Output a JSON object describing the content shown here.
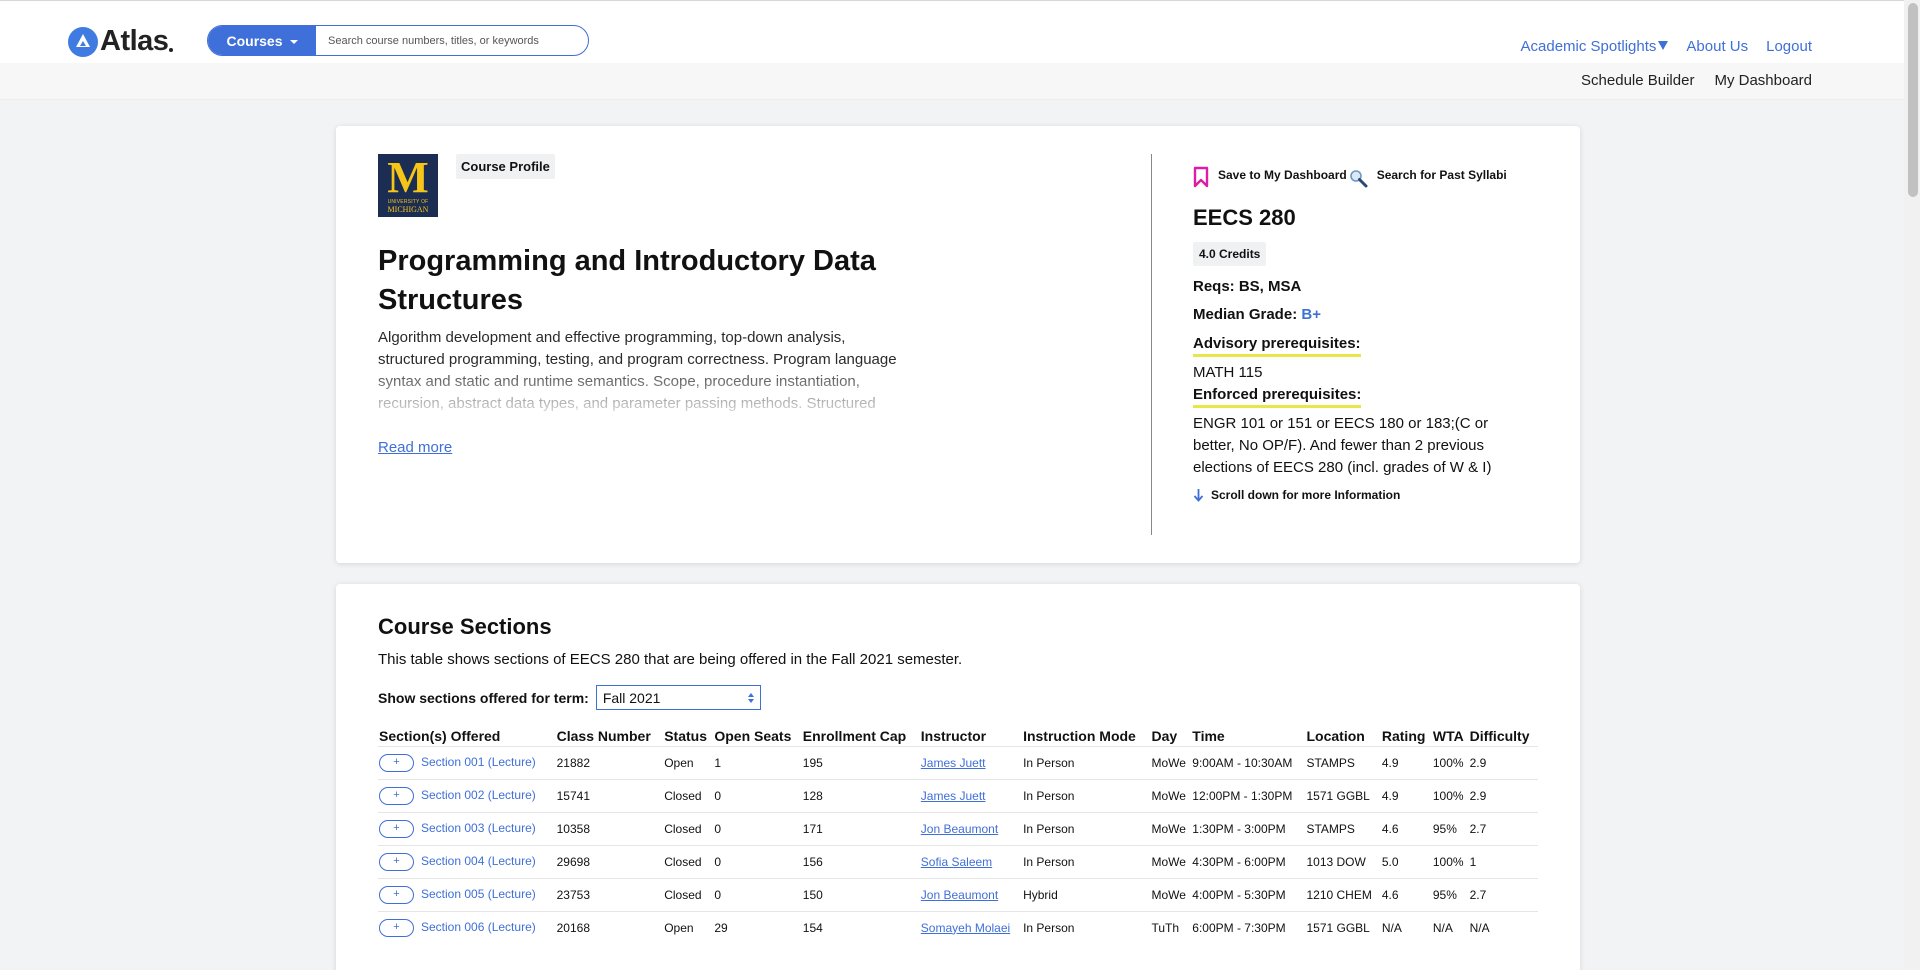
{
  "header": {
    "logo_text": "Atlas",
    "courses_label": "Courses",
    "search_placeholder": "Search course numbers, titles, or keywords",
    "nav_links": [
      "Academic Spotlights",
      "About Us",
      "Logout"
    ],
    "sub_links": [
      "Schedule Builder",
      "My Dashboard"
    ]
  },
  "colors": {
    "accent": "#3f6fd8",
    "highlight": "#e9e64a",
    "bookmark": "#e01ca4",
    "um_blue": "#1b2d52",
    "um_maize": "#f5c518"
  },
  "profile": {
    "logo_letter": "M",
    "logo_university": "UNIVERSITY OF",
    "logo_michigan": "MICHIGAN",
    "badge": "Course Profile",
    "title": "Programming and Introductory Data Structures",
    "description": "Algorithm development and effective programming, top-down analysis, structured programming, testing, and program correctness. Program language syntax and static and runtime semantics. Scope, procedure instantiation, recursion, abstract data types, and parameter passing methods. Structured",
    "read_more": "Read more",
    "save_label": "Save to My Dashboard",
    "syllabi_label": "Search for Past Syllabi",
    "code": "EECS 280",
    "credits": "4.0 Credits",
    "reqs": "Reqs: BS, MSA",
    "median_label": "Median Grade:",
    "median_value": "B+",
    "advisory_heading": "Advisory prerequisites:",
    "advisory_value": "MATH 115",
    "enforced_heading": "Enforced prerequisites:",
    "enforced_value": "ENGR 101 or 151 or EECS 180 or 183;(C or better, No OP/F). And fewer than 2 previous elections of EECS 280 (incl. grades of W & I)",
    "scroll_more": "Scroll down for more Information"
  },
  "sections": {
    "title": "Course Sections",
    "description": "This table shows sections of EECS 280 that are being offered in the Fall 2021 semester.",
    "term_label": "Show sections offered for term:",
    "term_value": "Fall 2021",
    "plus_label": "+",
    "columns": [
      "Section(s) Offered",
      "Class Number",
      "Status",
      "Open Seats",
      "Enrollment Cap",
      "Instructor",
      "Instruction Mode",
      "Day",
      "Time",
      "Location",
      "Rating",
      "WTA",
      "Difficulty"
    ],
    "rows": [
      [
        "Section 001 (Lecture)",
        "21882",
        "Open",
        "1",
        "195",
        "James Juett",
        "In Person",
        "MoWe",
        "9:00AM - 10:30AM",
        "STAMPS",
        "4.9",
        "100%",
        "2.9"
      ],
      [
        "Section 002 (Lecture)",
        "15741",
        "Closed",
        "0",
        "128",
        "James Juett",
        "In Person",
        "MoWe",
        "12:00PM - 1:30PM",
        "1571 GGBL",
        "4.9",
        "100%",
        "2.9"
      ],
      [
        "Section 003 (Lecture)",
        "10358",
        "Closed",
        "0",
        "171",
        "Jon Beaumont",
        "In Person",
        "MoWe",
        "1:30PM - 3:00PM",
        "STAMPS",
        "4.6",
        "95%",
        "2.7"
      ],
      [
        "Section 004 (Lecture)",
        "29698",
        "Closed",
        "0",
        "156",
        "Sofia Saleem",
        "In Person",
        "MoWe",
        "4:30PM - 6:00PM",
        "1013 DOW",
        "5.0",
        "100%",
        "1"
      ],
      [
        "Section 005 (Lecture)",
        "23753",
        "Closed",
        "0",
        "150",
        "Jon Beaumont",
        "Hybrid",
        "MoWe",
        "4:00PM - 5:30PM",
        "1210 CHEM",
        "4.6",
        "95%",
        "2.7"
      ],
      [
        "Section 006 (Lecture)",
        "20168",
        "Open",
        "29",
        "154",
        "Somayeh Molaei",
        "In Person",
        "TuTh",
        "6:00PM - 7:30PM",
        "1571 GGBL",
        "N/A",
        "N/A",
        "N/A"
      ]
    ]
  }
}
